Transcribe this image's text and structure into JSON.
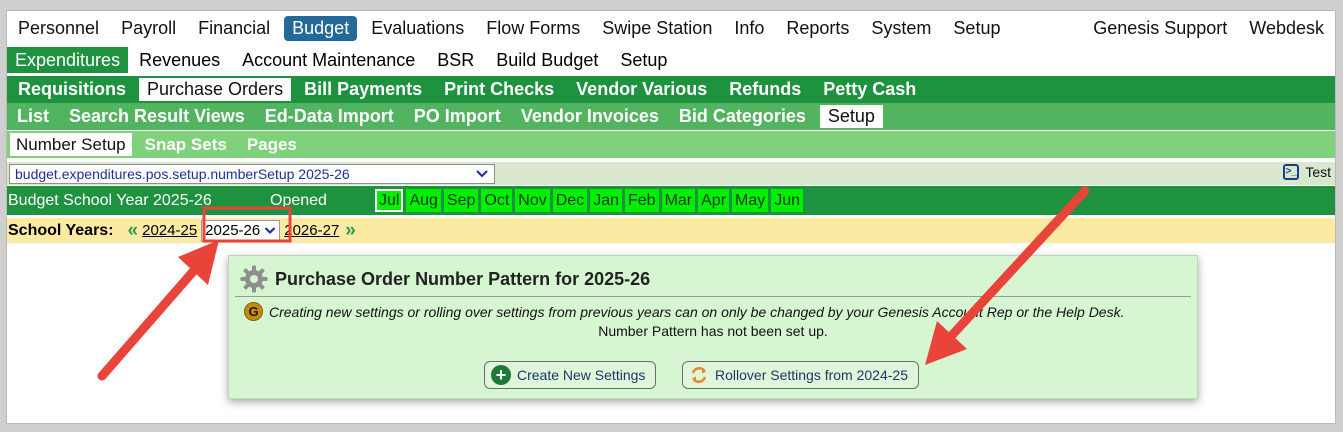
{
  "top_nav": [
    "Personnel",
    "Payroll",
    "Financial",
    "Budget",
    "Evaluations",
    "Flow Forms",
    "Swipe Station",
    "Info",
    "Reports",
    "System",
    "Setup"
  ],
  "top_nav_right": [
    "Genesis Support",
    "Webdesk"
  ],
  "nav_level2": [
    "Expenditures",
    "Revenues",
    "Account Maintenance",
    "BSR",
    "Build Budget",
    "Setup"
  ],
  "nav_level3": [
    "Requisitions",
    "Purchase Orders",
    "Bill Payments",
    "Print Checks",
    "Vendor Various",
    "Refunds",
    "Petty Cash"
  ],
  "nav_level4": [
    "List",
    "Search Result Views",
    "Ed-Data Import",
    "PO Import",
    "Vendor Invoices",
    "Bid Categories",
    "Setup"
  ],
  "nav_level5": [
    "Number Setup",
    "Snap Sets",
    "Pages"
  ],
  "path_select": {
    "value": "budget.expenditures.pos.setup.numberSetup 2025-26"
  },
  "test_label": "Test",
  "budget_bar": {
    "year_label": "Budget School Year 2025-26",
    "status": "Opened",
    "months": [
      "Jul",
      "Aug",
      "Sep",
      "Oct",
      "Nov",
      "Dec",
      "Jan",
      "Feb",
      "Mar",
      "Apr",
      "May",
      "Jun"
    ]
  },
  "school_years": {
    "label": "School Years:",
    "prev": "2024-25",
    "current": "2025-26",
    "next": "2026-27"
  },
  "panel": {
    "title": "Purchase Order Number Pattern for 2025-26",
    "notice": "Creating new settings or rolling over settings from previous years can on only be changed by your Genesis Account Rep or the Help Desk.",
    "pattern_message": "Number Pattern has not been set up.",
    "create_button": "Create New Settings",
    "rollover_button": "Rollover Settings from 2024-25"
  },
  "colors": {
    "active_top": "#236a9a",
    "nav_green": "#1f9240",
    "month_green": "#00ef00",
    "year_bar": "#fbeaa2",
    "panel_bg": "#d6f6d1",
    "annotation_red": "#e8443a"
  }
}
